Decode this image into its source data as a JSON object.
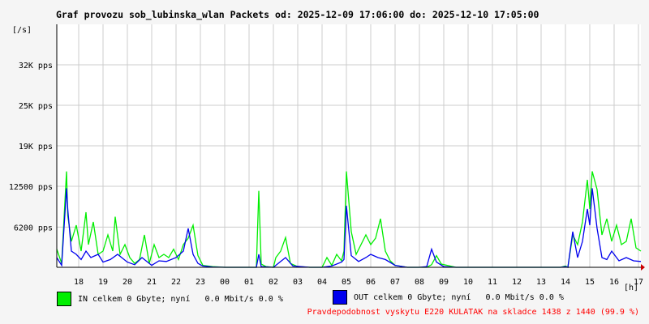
{
  "chart_data": {
    "type": "area",
    "title": "Graf provozu sob_lubinska_wlan Packets od: 2025-12-09 17:06:00 do: 2025-12-10 17:05:00",
    "ylabel": "[/s]",
    "xlabel": "[h]",
    "ylim": [
      0,
      37500
    ],
    "y_ticks": [
      {
        "value": 6200,
        "label": "6200 pps"
      },
      {
        "value": 12500,
        "label": "12500 pps"
      },
      {
        "value": 18750,
        "label": "19K pps"
      },
      {
        "value": 25000,
        "label": "25K pps"
      },
      {
        "value": 31250,
        "label": "32K pps"
      }
    ],
    "x_range": [
      17.1,
      41.1
    ],
    "x_ticks": [
      {
        "value": 18,
        "label": "18"
      },
      {
        "value": 19,
        "label": "19"
      },
      {
        "value": 20,
        "label": "20"
      },
      {
        "value": 21,
        "label": "21"
      },
      {
        "value": 22,
        "label": "22"
      },
      {
        "value": 23,
        "label": "23"
      },
      {
        "value": 24,
        "label": "00"
      },
      {
        "value": 25,
        "label": "01"
      },
      {
        "value": 26,
        "label": "02"
      },
      {
        "value": 27,
        "label": "03"
      },
      {
        "value": 28,
        "label": "04"
      },
      {
        "value": 29,
        "label": "05"
      },
      {
        "value": 30,
        "label": "06"
      },
      {
        "value": 31,
        "label": "07"
      },
      {
        "value": 32,
        "label": "08"
      },
      {
        "value": 33,
        "label": "09"
      },
      {
        "value": 34,
        "label": "10"
      },
      {
        "value": 35,
        "label": "11"
      },
      {
        "value": 36,
        "label": "12"
      },
      {
        "value": 37,
        "label": "13"
      },
      {
        "value": 38,
        "label": "14"
      },
      {
        "value": 39,
        "label": "15"
      },
      {
        "value": 40,
        "label": "16"
      },
      {
        "value": 41,
        "label": "17"
      }
    ],
    "grid": true,
    "series": [
      {
        "name": "IN",
        "color": "#00ee00",
        "x": [
          17.1,
          17.3,
          17.5,
          17.55,
          17.7,
          17.9,
          18.1,
          18.3,
          18.4,
          18.6,
          18.8,
          19.0,
          19.2,
          19.4,
          19.5,
          19.7,
          19.9,
          20.1,
          20.3,
          20.5,
          20.7,
          20.9,
          21.1,
          21.3,
          21.5,
          21.7,
          21.9,
          22.1,
          22.3,
          22.5,
          22.7,
          22.9,
          23.1,
          23.5,
          24.0,
          24.5,
          25.0,
          25.3,
          25.4,
          25.5,
          25.7,
          26.0,
          26.1,
          26.3,
          26.5,
          26.7,
          27.0,
          27.5,
          28.0,
          28.2,
          28.4,
          28.6,
          28.8,
          28.9,
          29.0,
          29.2,
          29.4,
          29.6,
          29.8,
          30.0,
          30.2,
          30.4,
          30.6,
          30.8,
          31.0,
          31.5,
          32.0,
          32.3,
          32.5,
          32.7,
          32.9,
          33.5,
          34.0,
          34.5,
          35.0,
          35.5,
          36.0,
          36.5,
          37.0,
          37.5,
          37.8,
          38.0,
          38.1,
          38.3,
          38.5,
          38.7,
          38.9,
          39.0,
          39.1,
          39.3,
          39.5,
          39.7,
          39.9,
          40.1,
          40.3,
          40.5,
          40.7,
          40.9,
          41.1
        ],
        "values": [
          2800,
          600,
          14800,
          8000,
          4000,
          6500,
          2500,
          8500,
          3500,
          7000,
          2000,
          2500,
          5000,
          2500,
          7800,
          2000,
          3500,
          1500,
          600,
          1200,
          5000,
          600,
          3500,
          1500,
          2000,
          1500,
          2800,
          1200,
          3500,
          4500,
          6500,
          1800,
          300,
          100,
          0,
          0,
          0,
          0,
          11800,
          500,
          100,
          0,
          1500,
          2500,
          4600,
          600,
          100,
          0,
          0,
          1500,
          300,
          2000,
          1000,
          2500,
          14800,
          5500,
          2000,
          3500,
          5000,
          3500,
          4500,
          7500,
          2500,
          1000,
          300,
          0,
          0,
          0,
          400,
          1800,
          500,
          0,
          0,
          0,
          0,
          0,
          0,
          0,
          0,
          0,
          0,
          200,
          0,
          5000,
          3500,
          7000,
          13500,
          9000,
          14800,
          12000,
          5000,
          7500,
          4000,
          6500,
          3500,
          4000,
          7500,
          3000,
          2500
        ]
      },
      {
        "name": "OUT",
        "color": "#0000ee",
        "x": [
          17.1,
          17.3,
          17.5,
          17.55,
          17.7,
          17.9,
          18.1,
          18.3,
          18.5,
          18.8,
          19.0,
          19.3,
          19.6,
          20.0,
          20.3,
          20.6,
          21.0,
          21.3,
          21.6,
          22.0,
          22.3,
          22.5,
          22.7,
          22.9,
          23.1,
          23.5,
          24.0,
          25.0,
          25.3,
          25.4,
          25.5,
          26.0,
          26.3,
          26.5,
          26.8,
          27.5,
          28.0,
          28.4,
          28.8,
          28.9,
          29.0,
          29.2,
          29.5,
          29.8,
          30.0,
          30.3,
          30.6,
          31.0,
          31.5,
          32.0,
          32.3,
          32.5,
          32.7,
          33.0,
          33.5,
          34.5,
          35.5,
          36.5,
          37.5,
          37.8,
          38.0,
          38.1,
          38.3,
          38.5,
          38.7,
          38.9,
          39.0,
          39.1,
          39.3,
          39.5,
          39.7,
          39.9,
          40.2,
          40.5,
          40.8,
          41.1
        ],
        "values": [
          1500,
          300,
          12200,
          9000,
          2500,
          2000,
          1200,
          2500,
          1500,
          2000,
          800,
          1200,
          2000,
          800,
          400,
          1500,
          300,
          1000,
          900,
          1500,
          2500,
          6000,
          2000,
          600,
          200,
          50,
          0,
          0,
          0,
          2000,
          100,
          0,
          900,
          1500,
          200,
          0,
          0,
          200,
          800,
          1200,
          9500,
          1800,
          900,
          1500,
          2000,
          1500,
          1200,
          300,
          0,
          0,
          100,
          2800,
          800,
          100,
          0,
          0,
          0,
          0,
          0,
          0,
          100,
          0,
          5500,
          1500,
          4000,
          9000,
          6500,
          12200,
          6000,
          1500,
          1200,
          2500,
          1000,
          1500,
          1000,
          900
        ]
      }
    ],
    "legend_placement": "bottom"
  },
  "legend": {
    "in_text": "IN celkem 0 Gbyte; nyní   0.0 Mbit/s 0.0 %",
    "out_text": "OUT celkem 0 Gbyte; nyní   0.0 Mbit/s 0.0 %"
  },
  "footnote": "Pravdepodobnost vyskytu E220 KULATAK na skladce 1438 z 1440 (99.9 %)"
}
